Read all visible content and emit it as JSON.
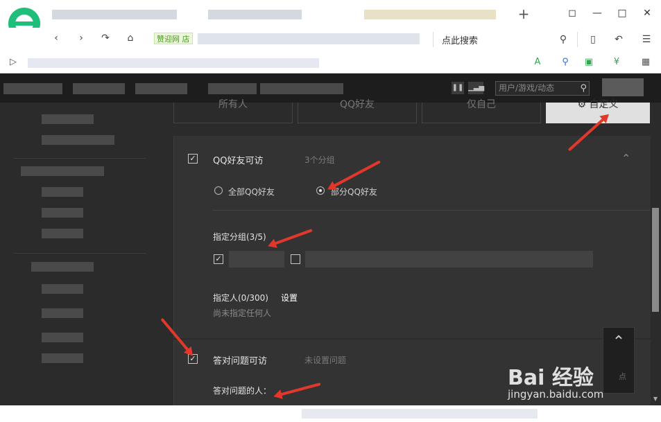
{
  "browser": {
    "address_tag": "赞迎网 店",
    "search_hint": "点此搜索"
  },
  "site": {
    "search_placeholder": "用户/游戏/动态"
  },
  "visibility_tabs": [
    {
      "label": "所有人",
      "active": false
    },
    {
      "label": "QQ好友",
      "active": false
    },
    {
      "label": "仅自己",
      "active": false
    },
    {
      "label": "自定义",
      "active": true
    }
  ],
  "qq_friends_section": {
    "checked": true,
    "title": "QQ好友可访",
    "subtitle": "3个分组",
    "options": [
      {
        "label": "全部QQ好友",
        "selected": false
      },
      {
        "label": "部分QQ好友",
        "selected": true
      }
    ],
    "groups_heading": "指定分组(3/5)",
    "group_items": [
      {
        "checked": true
      },
      {
        "checked": false
      }
    ],
    "people_label": "指定人(0/300)",
    "set_link": "设置",
    "people_empty": "尚未指定任何人"
  },
  "question_section": {
    "checked": true,
    "title": "答对问题可访",
    "subtitle": "未设置问题",
    "answerers_label": "答对问题的人："
  },
  "back_to_top": {
    "label": "点"
  },
  "watermark": {
    "brand": "Bai 经验",
    "url": "jingyan.baidu.com"
  },
  "colors": {
    "annotation_arrow": "#e2382c",
    "background": "#2b2b2b",
    "panel": "#333333",
    "active_tab": "#e0e0e0"
  }
}
